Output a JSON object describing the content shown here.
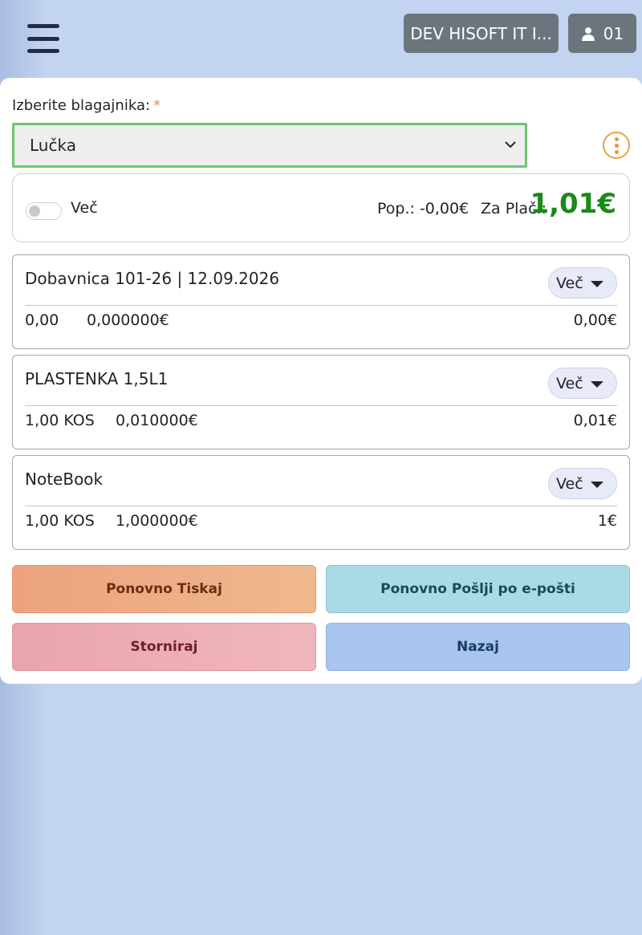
{
  "header": {
    "company_label": "DEV HISOFT IT I...",
    "user_label": "01"
  },
  "cashier": {
    "label": "Izberite blagajnika:",
    "required_mark": "*",
    "selected": "Lučka"
  },
  "summary": {
    "more_label": "Več",
    "discount_text": "Pop.: -0,00€",
    "to_pay_label": "Za Plač.:",
    "to_pay_value": "1,01€"
  },
  "items": [
    {
      "title": "Dobavnica 101-26 | 12.09.2026",
      "more": "Več",
      "qty": "0,00",
      "price": "0,000000€",
      "total": "0,00€"
    },
    {
      "title": "PLASTENKA 1,5L1",
      "more": "Več",
      "qty": "1,00 KOS",
      "price": "0,010000€",
      "total": "0,01€"
    },
    {
      "title": "NoteBook",
      "more": "Več",
      "qty": "1,00 KOS",
      "price": "1,000000€",
      "total": "1€"
    }
  ],
  "actions": {
    "reprint": "Ponovno Tiskaj",
    "resend_email": "Ponovno Pošlji po e-pošti",
    "storno": "Storniraj",
    "back": "Nazaj"
  },
  "colors": {
    "accent_green": "#1a8a1a",
    "select_border": "#6cc76c",
    "required": "#e8923e"
  }
}
